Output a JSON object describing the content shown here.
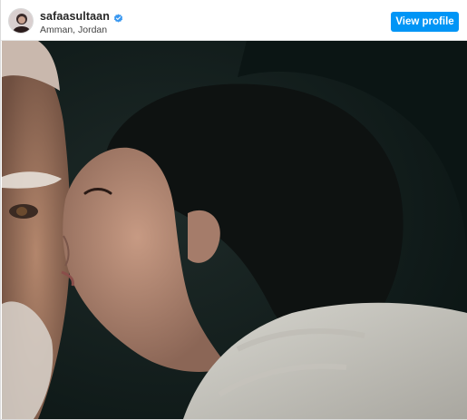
{
  "post": {
    "username": "safaasultaan",
    "location": "Amman, Jordan",
    "view_profile_label": "View profile",
    "verified_icon": "verified-badge-icon",
    "avatar_icon": "avatar"
  },
  "photo": {
    "subject": "photo-content"
  },
  "colors": {
    "accent": "#0095f6",
    "verified": "#3897f0",
    "photo_bg": "#0d1a19"
  }
}
